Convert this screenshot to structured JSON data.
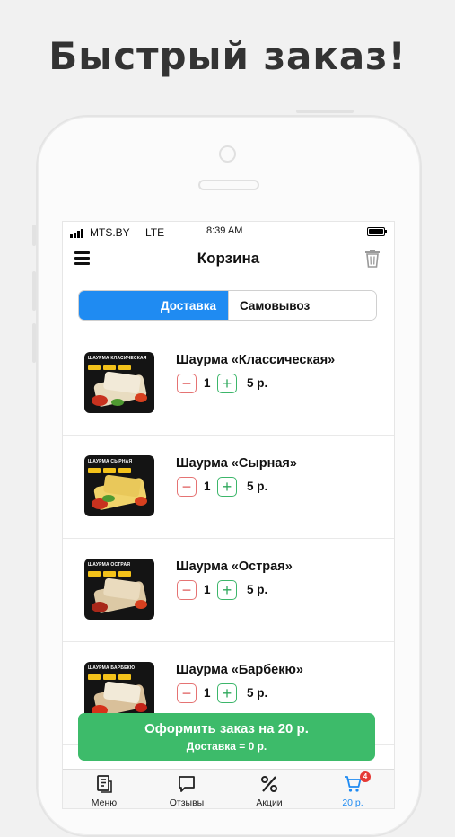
{
  "headline": "Быстрый заказ!",
  "status_bar": {
    "carrier": "MTS.BY",
    "network": "LTE",
    "time": "8:39 AM"
  },
  "nav": {
    "title": "Корзина",
    "menu_icon": "hamburger-menu-icon",
    "trash_icon": "trash-icon"
  },
  "segmented": {
    "options": [
      "Доставка",
      "Самовывоз"
    ],
    "selected": "Доставка",
    "active_color": "#1f8bf2"
  },
  "cart_items": [
    {
      "name": "Шаурма «Классическая»",
      "thumb_title": "ШАУРМА КЛАСИЧЕСКАЯ",
      "quantity": "1",
      "price": "5 р."
    },
    {
      "name": "Шаурма «Сырная»",
      "thumb_title": "ШАУРМА СЫРНАЯ",
      "quantity": "1",
      "price": "5 р."
    },
    {
      "name": "Шаурма «Острая»",
      "thumb_title": "ШАУРМА ОСТРАЯ",
      "quantity": "1",
      "price": "5 р."
    },
    {
      "name": "Шаурма «Барбекю»",
      "thumb_title": "ШАУРМА БАРБЕКЮ",
      "quantity": "1",
      "price": "5 р."
    }
  ],
  "checkout": {
    "label": "Оформить заказ на 20 р.",
    "delivery": "Доставка = 0 р.",
    "color": "#3dbb6a"
  },
  "tabbar": {
    "tabs": [
      {
        "label": "Меню",
        "icon": "menu-book-icon"
      },
      {
        "label": "Отзывы",
        "icon": "chat-bubble-icon"
      },
      {
        "label": "Акции",
        "icon": "percent-icon"
      },
      {
        "label": "20 р.",
        "icon": "cart-icon",
        "badge": "4"
      }
    ],
    "active_index": 3
  }
}
